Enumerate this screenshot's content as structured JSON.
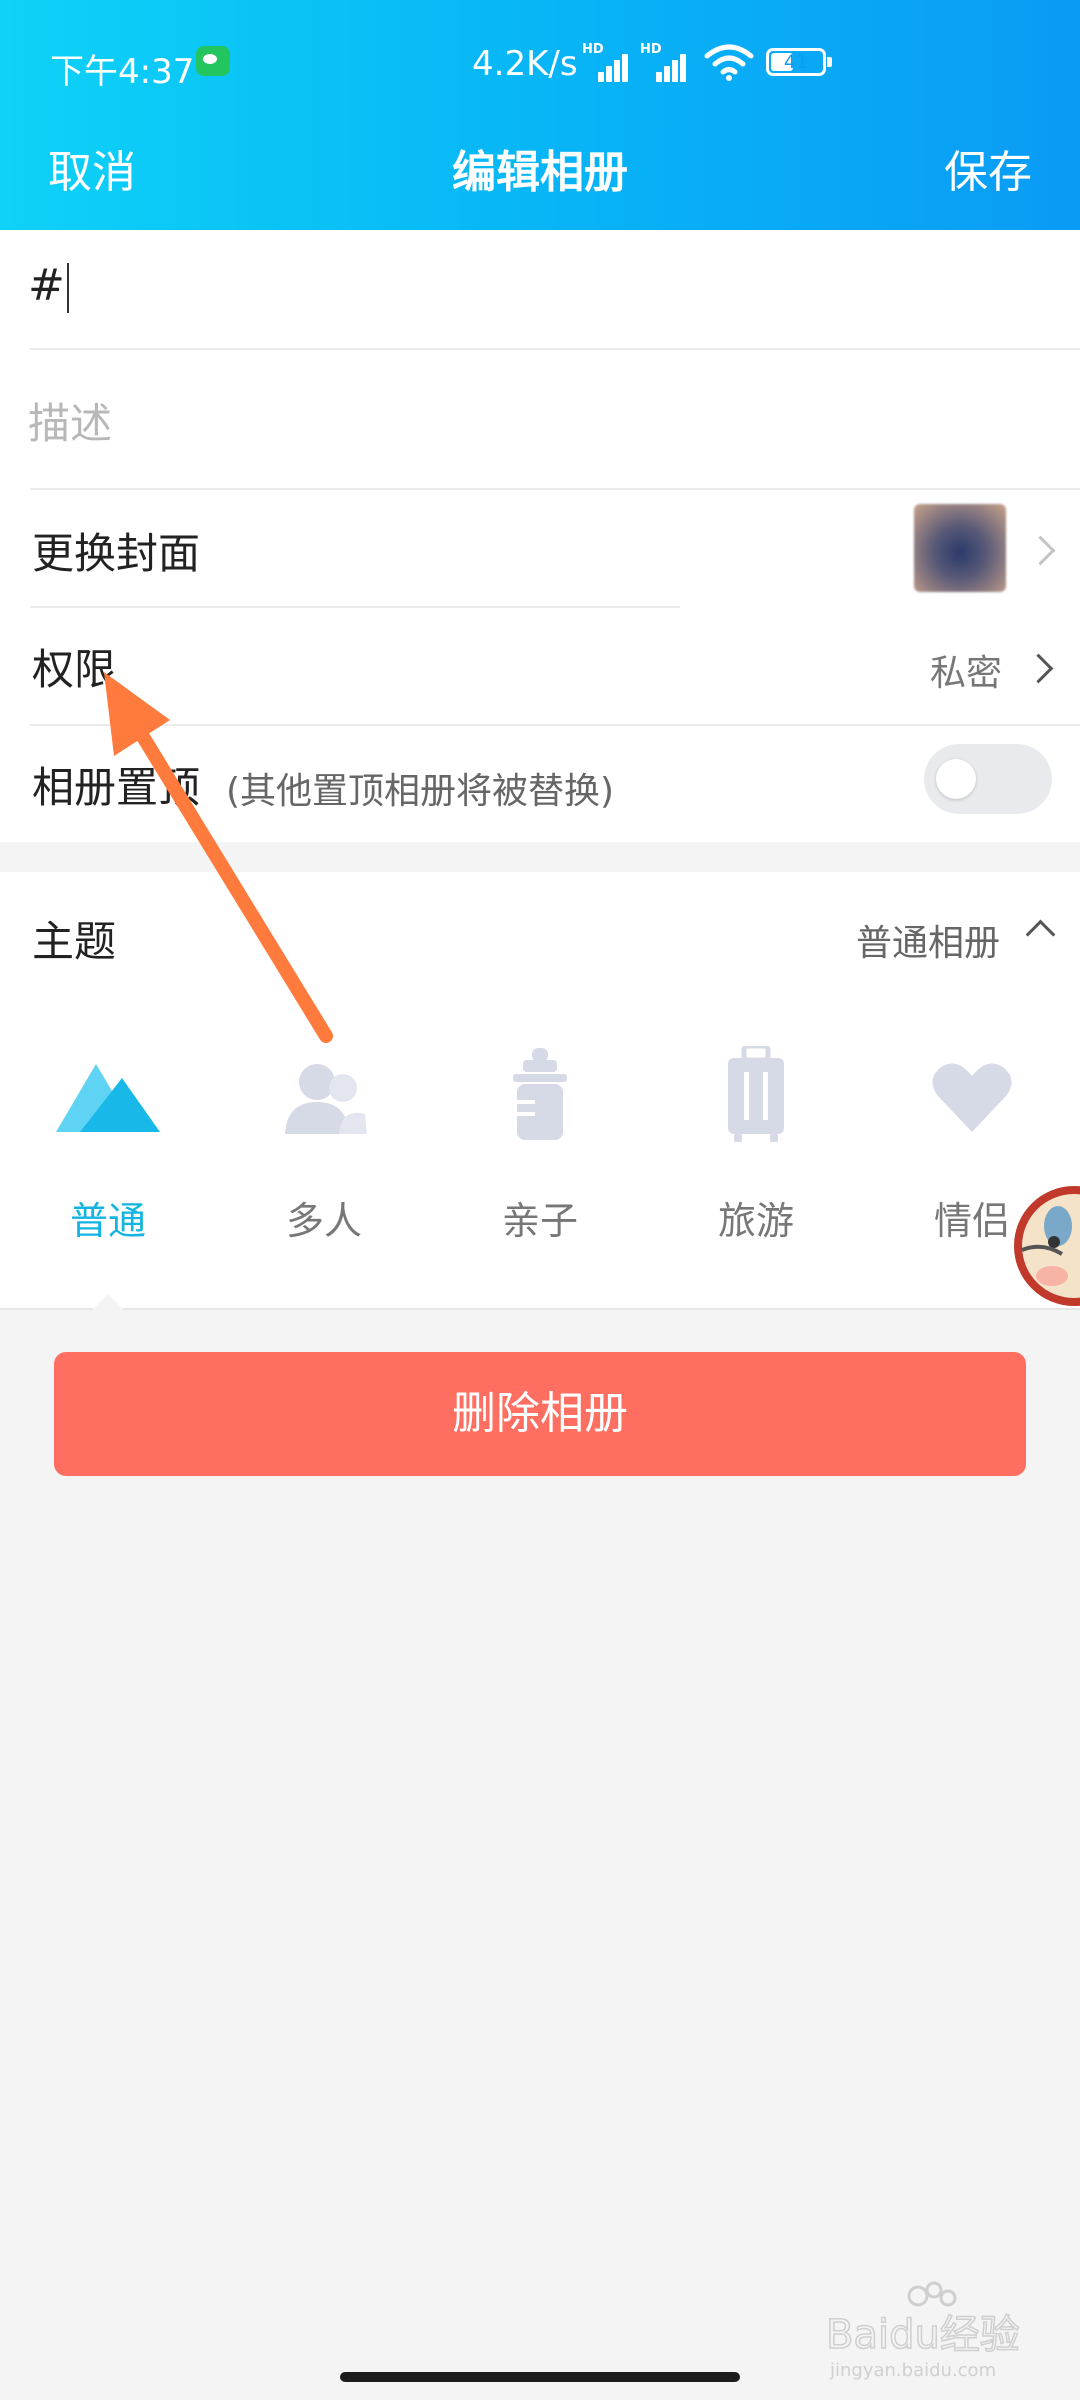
{
  "status_bar": {
    "time": "下午4:37",
    "net_speed": "4.2K/s",
    "sig1_label": "HD",
    "sig2_label": "HD",
    "battery": "41"
  },
  "nav": {
    "cancel": "取消",
    "title": "编辑相册",
    "save": "保存"
  },
  "form": {
    "name_value": "#",
    "description_placeholder": "描述",
    "cover_label": "更换封面",
    "permission_label": "权限",
    "permission_value": "私密",
    "pin_label": "相册置顶",
    "pin_note": "(其他置顶相册将被替换)",
    "pin_enabled": false
  },
  "theme": {
    "label": "主题",
    "value": "普通相册",
    "options": [
      {
        "label": "普通",
        "icon": "mountain-icon",
        "selected": true
      },
      {
        "label": "多人",
        "icon": "people-icon",
        "selected": false
      },
      {
        "label": "亲子",
        "icon": "baby-bottle-icon",
        "selected": false
      },
      {
        "label": "旅游",
        "icon": "suitcase-icon",
        "selected": false
      },
      {
        "label": "情侣",
        "icon": "heart-icon",
        "selected": false
      }
    ]
  },
  "delete_button": "删除相册",
  "watermark": {
    "brand": "Baidu经验",
    "url": "jingyan.baidu.com"
  },
  "colors": {
    "header_start": "#0ed2f7",
    "header_end": "#0a9bf5",
    "accent": "#13b5e0",
    "delete": "#ff6f61",
    "arrow": "#ff7a3d"
  }
}
